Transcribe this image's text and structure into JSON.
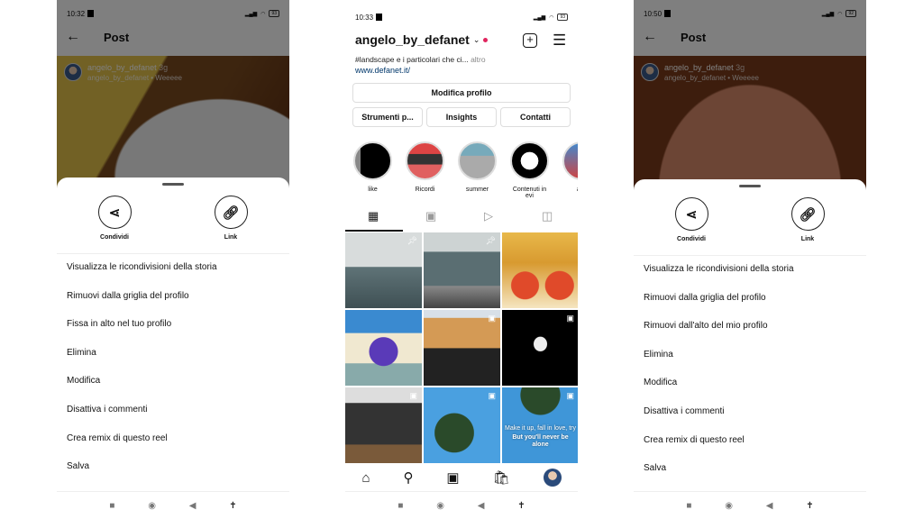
{
  "left": {
    "time": "10:32",
    "battery": "93",
    "title": "Post",
    "username": "angelo_by_defanet",
    "age": "3g",
    "subtitle": "angelo_by_defanet • Weeeee",
    "share": "Condividi",
    "link": "Link",
    "menu": [
      "Visualizza le ricondivisioni della storia",
      "Rimuovi dalla griglia del profilo",
      "Fissa in alto nel tuo profilo",
      "Elimina",
      "Modifica",
      "Disattiva i commenti",
      "Crea remix di questo reel",
      "Salva"
    ]
  },
  "center": {
    "time": "10:33",
    "battery": "93",
    "username": "angelo_by_defanet",
    "bio": "#landscape e i particolari che ci...",
    "more": "altro",
    "link": "www.defanet.it/",
    "edit_profile": "Modifica profilo",
    "tools": "Strumenti p...",
    "insights": "Insights",
    "contacts": "Contatti",
    "highlights": [
      "like",
      "Ricordi",
      "summer",
      "Contenuti in evi",
      "asp"
    ],
    "reel_caption": [
      "Make it up, fall in love, try",
      "But you'll never be alone"
    ]
  },
  "right": {
    "time": "10:50",
    "battery": "92",
    "title": "Post",
    "username": "angelo_by_defanet",
    "age": "3g",
    "subtitle": "angelo_by_defanet • Weeeee",
    "share": "Condividi",
    "link": "Link",
    "menu": [
      "Visualizza le ricondivisioni della storia",
      "Rimuovi dalla griglia del profilo",
      "Rimuovi dall'alto del mio profilo",
      "Elimina",
      "Modifica",
      "Disattiva i commenti",
      "Crea remix di questo reel",
      "Salva"
    ]
  },
  "colors": {
    "accent": "#0095f6",
    "notification_dot": "#e0245e",
    "link": "#00376b"
  }
}
